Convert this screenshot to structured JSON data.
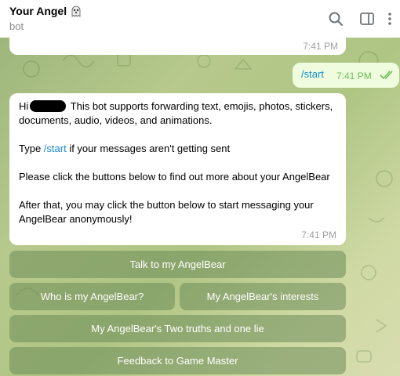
{
  "header": {
    "title": "Your Angel",
    "title_emoji_icon": "ghost-icon",
    "subtitle": "bot",
    "icons": [
      "search-icon",
      "sidebar-toggle-icon",
      "more-vert-icon"
    ]
  },
  "messages": {
    "prev": {
      "time": "7:41 PM"
    },
    "outgoing": {
      "text": "/start",
      "time": "7:41 PM",
      "status_icon": "double-check-icon"
    },
    "incoming": {
      "hi": "Hi",
      "intro": " This bot supports forwarding text, emojis, photos, stickers, documents, audio, videos, and animations.",
      "type_prefix": "Type ",
      "type_link": "/start",
      "type_suffix": " if your messages aren't getting sent",
      "para2": "Please click the buttons below to find out more about your AngelBear",
      "para3": "After that, you may click the button below to start messaging your AngelBear anonymously!",
      "time": "7:41 PM"
    }
  },
  "keyboard": {
    "talk": "Talk to my AngelBear",
    "who": "Who is my AngelBear?",
    "interests": "My AngelBear's interests",
    "truths": "My AngelBear's Two truths and one lie",
    "feedback": "Feedback to Game Master"
  },
  "colors": {
    "link": "#168acd",
    "outgoing_bubble": "#effdde",
    "check": "#6dbd58"
  }
}
